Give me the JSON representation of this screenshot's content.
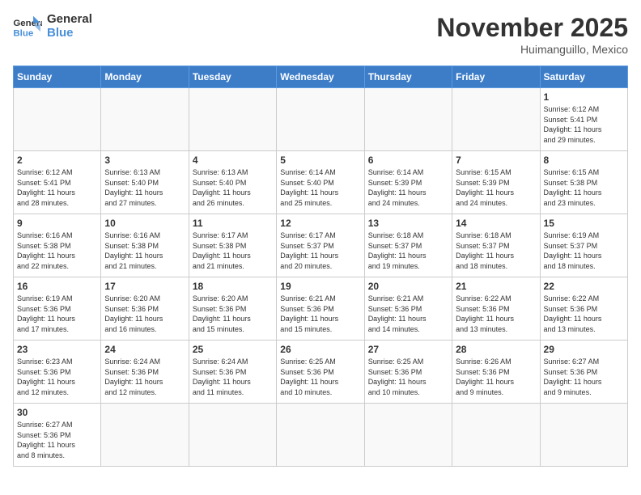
{
  "header": {
    "logo_general": "General",
    "logo_blue": "Blue",
    "month_title": "November 2025",
    "location": "Huimanguillo, Mexico"
  },
  "weekdays": [
    "Sunday",
    "Monday",
    "Tuesday",
    "Wednesday",
    "Thursday",
    "Friday",
    "Saturday"
  ],
  "weeks": [
    [
      {
        "day": "",
        "info": ""
      },
      {
        "day": "",
        "info": ""
      },
      {
        "day": "",
        "info": ""
      },
      {
        "day": "",
        "info": ""
      },
      {
        "day": "",
        "info": ""
      },
      {
        "day": "",
        "info": ""
      },
      {
        "day": "1",
        "info": "Sunrise: 6:12 AM\nSunset: 5:41 PM\nDaylight: 11 hours\nand 29 minutes."
      }
    ],
    [
      {
        "day": "2",
        "info": "Sunrise: 6:12 AM\nSunset: 5:41 PM\nDaylight: 11 hours\nand 28 minutes."
      },
      {
        "day": "3",
        "info": "Sunrise: 6:13 AM\nSunset: 5:40 PM\nDaylight: 11 hours\nand 27 minutes."
      },
      {
        "day": "4",
        "info": "Sunrise: 6:13 AM\nSunset: 5:40 PM\nDaylight: 11 hours\nand 26 minutes."
      },
      {
        "day": "5",
        "info": "Sunrise: 6:14 AM\nSunset: 5:40 PM\nDaylight: 11 hours\nand 25 minutes."
      },
      {
        "day": "6",
        "info": "Sunrise: 6:14 AM\nSunset: 5:39 PM\nDaylight: 11 hours\nand 24 minutes."
      },
      {
        "day": "7",
        "info": "Sunrise: 6:15 AM\nSunset: 5:39 PM\nDaylight: 11 hours\nand 24 minutes."
      },
      {
        "day": "8",
        "info": "Sunrise: 6:15 AM\nSunset: 5:38 PM\nDaylight: 11 hours\nand 23 minutes."
      }
    ],
    [
      {
        "day": "9",
        "info": "Sunrise: 6:16 AM\nSunset: 5:38 PM\nDaylight: 11 hours\nand 22 minutes."
      },
      {
        "day": "10",
        "info": "Sunrise: 6:16 AM\nSunset: 5:38 PM\nDaylight: 11 hours\nand 21 minutes."
      },
      {
        "day": "11",
        "info": "Sunrise: 6:17 AM\nSunset: 5:38 PM\nDaylight: 11 hours\nand 21 minutes."
      },
      {
        "day": "12",
        "info": "Sunrise: 6:17 AM\nSunset: 5:37 PM\nDaylight: 11 hours\nand 20 minutes."
      },
      {
        "day": "13",
        "info": "Sunrise: 6:18 AM\nSunset: 5:37 PM\nDaylight: 11 hours\nand 19 minutes."
      },
      {
        "day": "14",
        "info": "Sunrise: 6:18 AM\nSunset: 5:37 PM\nDaylight: 11 hours\nand 18 minutes."
      },
      {
        "day": "15",
        "info": "Sunrise: 6:19 AM\nSunset: 5:37 PM\nDaylight: 11 hours\nand 18 minutes."
      }
    ],
    [
      {
        "day": "16",
        "info": "Sunrise: 6:19 AM\nSunset: 5:36 PM\nDaylight: 11 hours\nand 17 minutes."
      },
      {
        "day": "17",
        "info": "Sunrise: 6:20 AM\nSunset: 5:36 PM\nDaylight: 11 hours\nand 16 minutes."
      },
      {
        "day": "18",
        "info": "Sunrise: 6:20 AM\nSunset: 5:36 PM\nDaylight: 11 hours\nand 15 minutes."
      },
      {
        "day": "19",
        "info": "Sunrise: 6:21 AM\nSunset: 5:36 PM\nDaylight: 11 hours\nand 15 minutes."
      },
      {
        "day": "20",
        "info": "Sunrise: 6:21 AM\nSunset: 5:36 PM\nDaylight: 11 hours\nand 14 minutes."
      },
      {
        "day": "21",
        "info": "Sunrise: 6:22 AM\nSunset: 5:36 PM\nDaylight: 11 hours\nand 13 minutes."
      },
      {
        "day": "22",
        "info": "Sunrise: 6:22 AM\nSunset: 5:36 PM\nDaylight: 11 hours\nand 13 minutes."
      }
    ],
    [
      {
        "day": "23",
        "info": "Sunrise: 6:23 AM\nSunset: 5:36 PM\nDaylight: 11 hours\nand 12 minutes."
      },
      {
        "day": "24",
        "info": "Sunrise: 6:24 AM\nSunset: 5:36 PM\nDaylight: 11 hours\nand 12 minutes."
      },
      {
        "day": "25",
        "info": "Sunrise: 6:24 AM\nSunset: 5:36 PM\nDaylight: 11 hours\nand 11 minutes."
      },
      {
        "day": "26",
        "info": "Sunrise: 6:25 AM\nSunset: 5:36 PM\nDaylight: 11 hours\nand 10 minutes."
      },
      {
        "day": "27",
        "info": "Sunrise: 6:25 AM\nSunset: 5:36 PM\nDaylight: 11 hours\nand 10 minutes."
      },
      {
        "day": "28",
        "info": "Sunrise: 6:26 AM\nSunset: 5:36 PM\nDaylight: 11 hours\nand 9 minutes."
      },
      {
        "day": "29",
        "info": "Sunrise: 6:27 AM\nSunset: 5:36 PM\nDaylight: 11 hours\nand 9 minutes."
      }
    ],
    [
      {
        "day": "30",
        "info": "Sunrise: 6:27 AM\nSunset: 5:36 PM\nDaylight: 11 hours\nand 8 minutes."
      },
      {
        "day": "",
        "info": ""
      },
      {
        "day": "",
        "info": ""
      },
      {
        "day": "",
        "info": ""
      },
      {
        "day": "",
        "info": ""
      },
      {
        "day": "",
        "info": ""
      },
      {
        "day": "",
        "info": ""
      }
    ]
  ]
}
